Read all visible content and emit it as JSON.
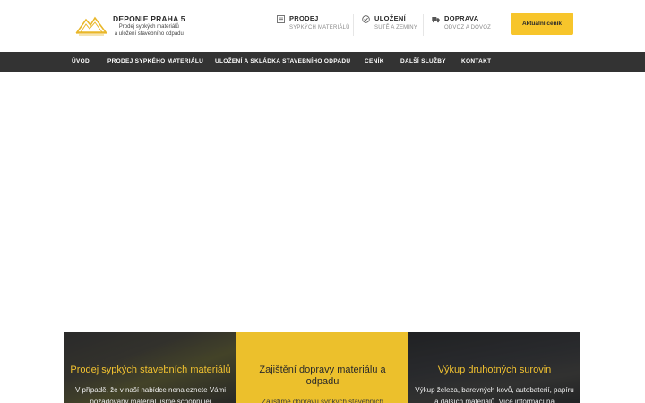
{
  "header": {
    "logo": {
      "title": "DEPONIE PRAHA 5",
      "subtitle_line1": "Prodej sypkých materiálů",
      "subtitle_line2": "a uložení stavebního odpadu"
    },
    "info": [
      {
        "title": "PRODEJ",
        "sub": "SYPKÝCH MATERIÁLŮ",
        "icon": "list-icon"
      },
      {
        "title": "ULOŽENÍ",
        "sub": "SUTĚ A ZEMINY",
        "icon": "check-circle-icon"
      },
      {
        "title": "DOPRAVA",
        "sub": "ODVOZ A DOVOZ",
        "icon": "truck-icon"
      }
    ],
    "cta_label": "Aktuální ceník"
  },
  "nav": {
    "items": [
      "ÚVOD",
      "PRODEJ SYPKÉHO MATERIÁLU",
      "ULOŽENÍ A SKLÁDKA STAVEBNÍHO ODPADU",
      "CENÍK",
      "DALŠÍ SLUŽBY",
      "KONTAKT"
    ]
  },
  "cards": [
    {
      "title": "Prodej sypkých stavebních materiálů",
      "text": "V případě, že v naší nabídce nenaleznete Vámi požadovaný materiál, jsme schopni jej"
    },
    {
      "title": "Zajištění dopravy materiálu a odpadu",
      "text": "Zajistíme dopravu sypkých stavebních"
    },
    {
      "title": "Výkup druhotných surovin",
      "text": "Výkup železa, barevných kovů, autobaterií, papíru a dalších materiálů. Více informací na"
    }
  ],
  "colors": {
    "accent": "#f7c52b",
    "nav_bg": "#333333",
    "card_title": "#f2c230"
  }
}
